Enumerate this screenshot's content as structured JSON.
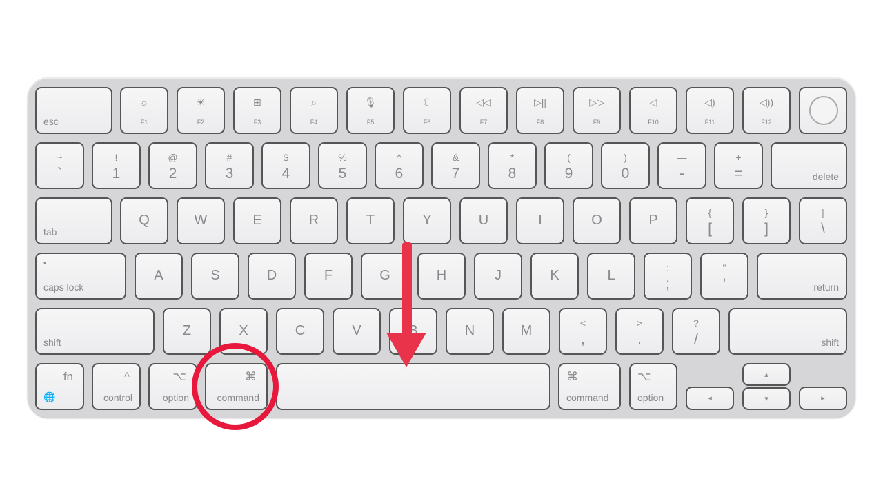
{
  "keyboard": {
    "row1": {
      "esc": "esc",
      "fkeys": [
        {
          "icon": "☼",
          "label": "F1",
          "name": "brightness-down-icon"
        },
        {
          "icon": "☀",
          "label": "F2",
          "name": "brightness-up-icon"
        },
        {
          "icon": "⊞",
          "label": "F3",
          "name": "mission-control-icon"
        },
        {
          "icon": "⌕",
          "label": "F4",
          "name": "search-icon"
        },
        {
          "icon": "🎙",
          "label": "F5",
          "name": "microphone-icon"
        },
        {
          "icon": "☾",
          "label": "F6",
          "name": "moon-icon"
        },
        {
          "icon": "◁◁",
          "label": "F7",
          "name": "rewind-icon"
        },
        {
          "icon": "▷||",
          "label": "F8",
          "name": "play-pause-icon"
        },
        {
          "icon": "▷▷",
          "label": "F9",
          "name": "fast-forward-icon"
        },
        {
          "icon": "◁",
          "label": "F10",
          "name": "mute-icon"
        },
        {
          "icon": "◁)",
          "label": "F11",
          "name": "volume-down-icon"
        },
        {
          "icon": "◁))",
          "label": "F12",
          "name": "volume-up-icon"
        }
      ]
    },
    "row2": {
      "keys": [
        [
          "~",
          "`"
        ],
        [
          "!",
          "1"
        ],
        [
          "@",
          "2"
        ],
        [
          "#",
          "3"
        ],
        [
          "$",
          "4"
        ],
        [
          "%",
          "5"
        ],
        [
          "^",
          "6"
        ],
        [
          "&",
          "7"
        ],
        [
          "*",
          "8"
        ],
        [
          "(",
          "9"
        ],
        [
          ")",
          "0"
        ],
        [
          "—",
          "-"
        ],
        [
          "+",
          "="
        ]
      ],
      "delete": "delete"
    },
    "row3": {
      "tab": "tab",
      "keys": [
        "Q",
        "W",
        "E",
        "R",
        "T",
        "Y",
        "U",
        "I",
        "O",
        "P"
      ],
      "brackets": [
        [
          "{",
          "["
        ],
        [
          "}",
          "]"
        ],
        [
          "|",
          "\\"
        ]
      ]
    },
    "row4": {
      "caps": "caps lock",
      "keys": [
        "A",
        "S",
        "D",
        "F",
        "G",
        "H",
        "J",
        "K",
        "L"
      ],
      "punct": [
        [
          ":",
          ";"
        ],
        [
          "\"",
          "'"
        ]
      ],
      "return": "return"
    },
    "row5": {
      "shift_left": "shift",
      "keys": [
        "Z",
        "X",
        "C",
        "V",
        "B",
        "N",
        "M"
      ],
      "punct": [
        [
          "<",
          ","
        ],
        [
          ">",
          "."
        ],
        [
          "?",
          "/"
        ]
      ],
      "shift_right": "shift"
    },
    "row6": {
      "fn": "fn",
      "globe": "🌐",
      "control": {
        "sym": "^",
        "label": "control"
      },
      "option_left": {
        "sym": "⌥",
        "label": "option"
      },
      "command_left": {
        "sym": "⌘",
        "label": "command"
      },
      "command_right": {
        "sym": "⌘",
        "label": "command"
      },
      "option_right": {
        "sym": "⌥",
        "label": "option"
      },
      "left": "◂",
      "up": "▴",
      "down": "▾",
      "right": "▸"
    }
  },
  "annotation": {
    "color": "#e8173c",
    "arrow_color": "#e8334a",
    "highlighted_key": "command"
  }
}
